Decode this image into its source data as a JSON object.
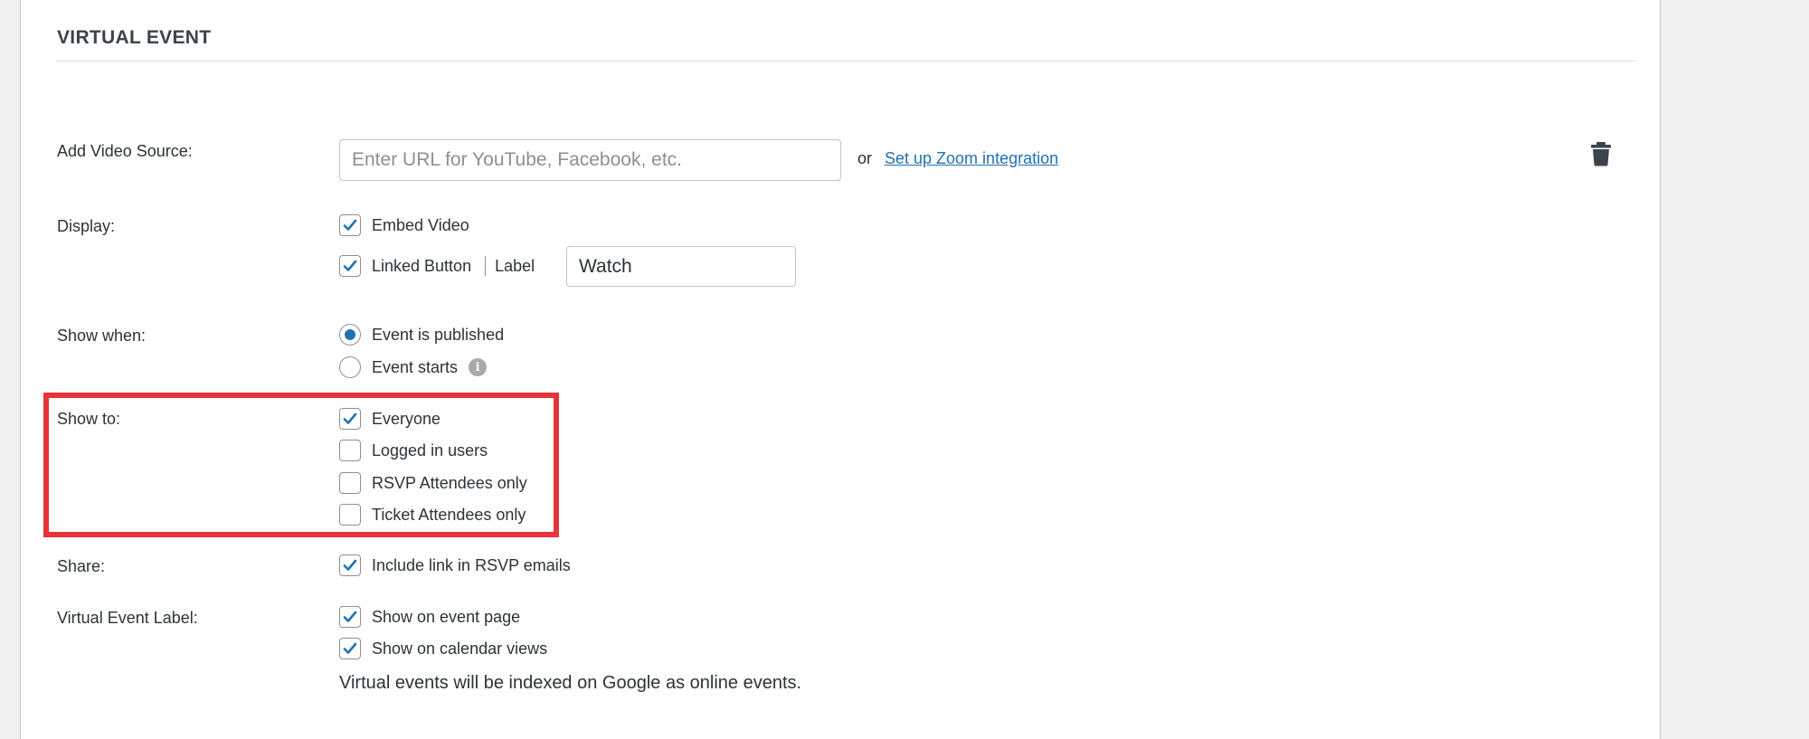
{
  "section": {
    "title": "VIRTUAL EVENT"
  },
  "video_source": {
    "label": "Add Video Source:",
    "placeholder": "Enter URL for YouTube, Facebook, etc.",
    "value": "",
    "or_text": "or",
    "zoom_link": "Set up Zoom integration",
    "delete_icon": "trash-icon"
  },
  "display": {
    "label": "Display:",
    "embed_video": {
      "label": "Embed Video",
      "checked": true
    },
    "linked_button": {
      "label": "Linked Button",
      "checked": true
    },
    "button_label_caption": "Label",
    "button_label_value": "Watch"
  },
  "show_when": {
    "label": "Show when:",
    "options": [
      {
        "label": "Event is published",
        "selected": true
      },
      {
        "label": "Event starts",
        "selected": false
      }
    ],
    "info_icon": "info-icon"
  },
  "show_to": {
    "label": "Show to:",
    "options": [
      {
        "label": "Everyone",
        "checked": true
      },
      {
        "label": "Logged in users",
        "checked": false
      },
      {
        "label": "RSVP Attendees only",
        "checked": false
      },
      {
        "label": "Ticket Attendees only",
        "checked": false
      }
    ]
  },
  "share": {
    "label": "Share:",
    "option": {
      "label": "Include link in RSVP emails",
      "checked": true
    }
  },
  "virtual_label": {
    "label": "Virtual Event Label:",
    "options": [
      {
        "label": "Show on event page",
        "checked": true
      },
      {
        "label": "Show on calendar views",
        "checked": true
      }
    ],
    "note": "Virtual events will be indexed on Google as online events."
  },
  "colors": {
    "accent": "#2271b1",
    "highlight_border": "#e8333b",
    "panel_background": "#ffffff",
    "page_background": "#f0f0f1"
  }
}
